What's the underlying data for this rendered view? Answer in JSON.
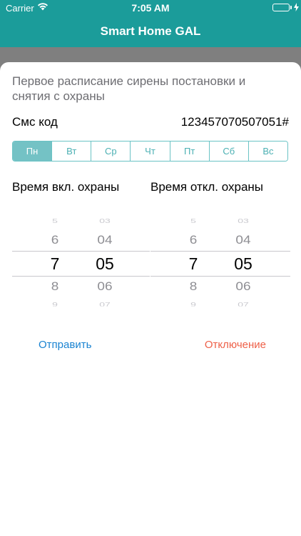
{
  "status_bar": {
    "carrier": "Carrier",
    "time": "7:05 AM",
    "wifi_icon": "wifi-icon",
    "battery_icon": "battery-icon",
    "charge_icon": "charging-bolt-icon",
    "battery_level": 1.0
  },
  "nav": {
    "title": "Smart Home GAL"
  },
  "sheet": {
    "title": "Первое расписание сирены постановки и снятия с охраны",
    "sms_label": "Смс код",
    "sms_value": "123457070507051#",
    "days": [
      "Пн",
      "Вт",
      "Ср",
      "Чт",
      "Пт",
      "Сб",
      "Вс"
    ],
    "selected_day": "Пн",
    "arm_label": "Время вкл. охраны",
    "disarm_label": "Время откл. охраны",
    "arm_picker": {
      "hours": [
        "5",
        "6",
        "7",
        "8",
        "9"
      ],
      "minutes": [
        "03",
        "04",
        "05",
        "06",
        "07"
      ],
      "selected_hour": "7",
      "selected_minute": "05"
    },
    "disarm_picker": {
      "hours": [
        "5",
        "6",
        "7",
        "8",
        "9"
      ],
      "minutes": [
        "03",
        "04",
        "05",
        "06",
        "07"
      ],
      "selected_hour": "7",
      "selected_minute": "05"
    },
    "send_label": "Отправить",
    "off_label": "Отключение"
  },
  "colors": {
    "brand": "#1b9c9a",
    "segment_selected": "#74c2c5",
    "send": "#1a83d1",
    "off": "#ee6048"
  }
}
